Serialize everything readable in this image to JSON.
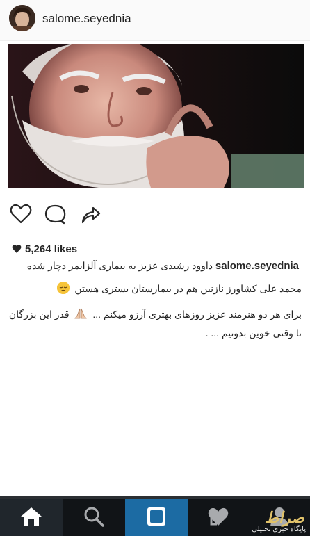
{
  "post": {
    "username": "salome.seyednia",
    "likes": "5,264 likes"
  },
  "caption": {
    "username": "salome.seyednia",
    "line1": "داوود رشیدی عزیز به بیماری آلزایمر دچار شده",
    "line2": "محمد علی کشاورز نازنین هم در بیمارستان بستری هستن",
    "line3a": "برای هر دو هنرمند عزیز روزهای بهتری آرزو میکنم ...",
    "line3b": "قدر این بزرگان تا وقتی خوین بدونیم ... ."
  },
  "watermark": {
    "logo": "صراط",
    "text": "پایگاه خبری تحلیلی"
  },
  "icons": {
    "like": "heart-outline-icon",
    "comment": "comment-bubble-icon",
    "share": "share-arrow-icon",
    "home": "home-icon",
    "search": "search-icon",
    "camera": "camera-icon",
    "activity": "heart-activity-icon",
    "profile": "profile-icon"
  },
  "colors": {
    "nav_background": "#111417",
    "camera_tab": "#1c6ba3",
    "home_tab": "#20262c"
  }
}
